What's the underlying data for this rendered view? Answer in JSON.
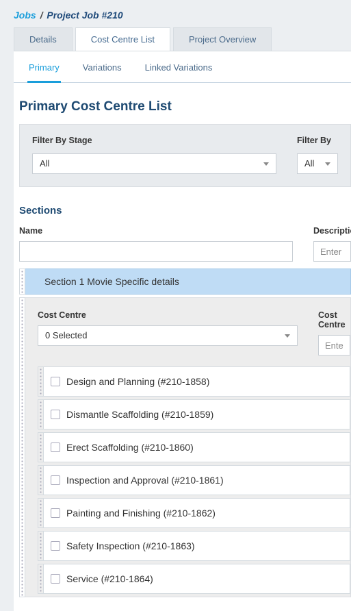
{
  "breadcrumb": {
    "root": "Jobs",
    "sep": "/",
    "current": "Project Job #210"
  },
  "main_tabs": {
    "details": "Details",
    "cost_centre_list": "Cost Centre List",
    "project_overview": "Project Overview"
  },
  "sub_tabs": {
    "primary": "Primary",
    "variations": "Variations",
    "linked_variations": "Linked Variations"
  },
  "heading": "Primary Cost Centre List",
  "filters": {
    "stage_label": "Filter By Stage",
    "stage_value": "All",
    "right_label": "Filter By",
    "right_value": "All"
  },
  "sections_heading": "Sections",
  "form": {
    "name_label": "Name",
    "desc_label": "Description",
    "desc_placeholder": "Enter a description"
  },
  "section": {
    "title": "Section 1 Movie Specific details"
  },
  "cost_centre": {
    "label": "Cost Centre",
    "selector_value": "0 Selected",
    "right_label": "Cost Centre",
    "right_placeholder": "Enter"
  },
  "cc_items": [
    "Design and Planning (#210-1858)",
    "Dismantle Scaffolding (#210-1859)",
    "Erect Scaffolding (#210-1860)",
    "Inspection and Approval (#210-1861)",
    "Painting and Finishing (#210-1862)",
    "Safety Inspection (#210-1863)",
    "Service (#210-1864)"
  ]
}
